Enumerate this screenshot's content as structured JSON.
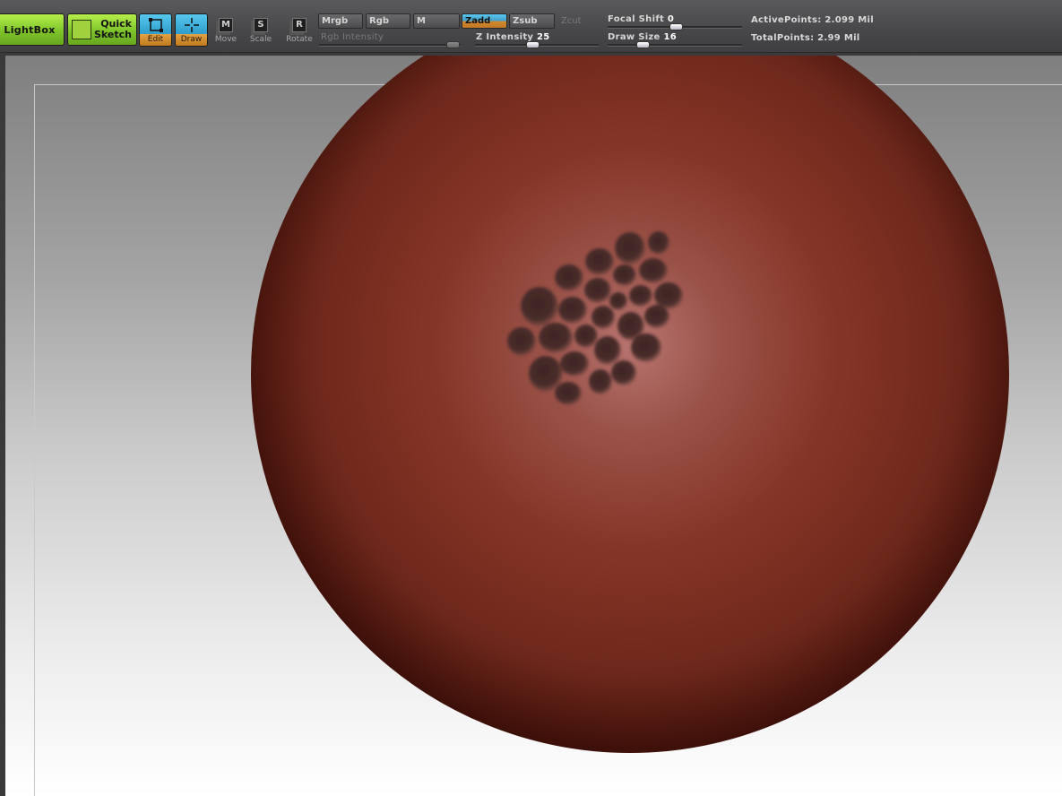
{
  "toolbar": {
    "lightbox_label": "LightBox",
    "quick_sketch_label_line1": "Quick",
    "quick_sketch_label_line2": "Sketch",
    "edit_label": "Edit",
    "draw_label": "Draw",
    "move_icon": "M",
    "move_label": "Move",
    "scale_icon": "S",
    "scale_label": "Scale",
    "rotate_icon": "R",
    "rotate_label": "Rotate",
    "mrgb_label": "Mrgb",
    "rgb_label": "Rgb",
    "m_label": "M",
    "zadd_label": "Zadd",
    "zsub_label": "Zsub",
    "zcut_label": "Zcut",
    "rgb_intensity_label": "Rgb Intensity",
    "z_intensity_label": "Z Intensity",
    "z_intensity_value": "25",
    "focal_shift_label": "Focal Shift",
    "focal_shift_value": "0",
    "draw_size_label": "Draw Size",
    "draw_size_value": "16",
    "active_points": "ActivePoints: 2.099  Mil",
    "total_points": "TotalPoints: 2.99  Mil"
  },
  "icons": {
    "lightbox": "none",
    "quick_sketch": "sketch-icon",
    "edit": "edit-transform-icon",
    "draw": "draw-crosshair-icon",
    "move": "move-icon",
    "scale": "scale-icon",
    "rotate": "rotate-icon"
  },
  "colors": {
    "toolbar_bg": "#4a4a4c",
    "lightbox_green": "#8fd433",
    "active_blue": "#3fb0df",
    "active_orange": "#d28a2f",
    "sphere_base": "#8a3324",
    "sphere_highlight": "#c07a78",
    "sculpt_spots": "#4a2a28"
  }
}
